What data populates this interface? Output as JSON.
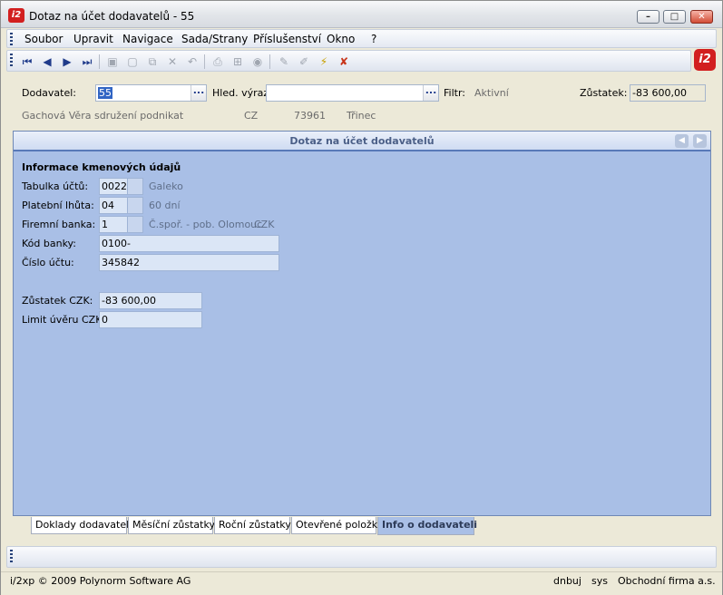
{
  "window": {
    "app_icon_text": "i2",
    "title": "Dotaz na účet dodavatelů - 55",
    "min_label": "–",
    "max_label": "□",
    "close_label": "✕"
  },
  "menu": {
    "items": [
      "Soubor",
      "Upravit",
      "Navigace",
      "Sada/Strany",
      "Příslušenství",
      "Okno",
      "?"
    ]
  },
  "toolbar": {
    "icons": [
      {
        "name": "first-record-icon",
        "glyph": "⏮"
      },
      {
        "name": "prev-record-icon",
        "glyph": "◀"
      },
      {
        "name": "next-record-icon",
        "glyph": "▶"
      },
      {
        "name": "last-record-icon",
        "glyph": "⏭"
      },
      {
        "name": "save-icon",
        "glyph": "▣"
      },
      {
        "name": "new-icon",
        "glyph": "▢"
      },
      {
        "name": "copy-icon",
        "glyph": "⧉"
      },
      {
        "name": "delete-icon",
        "glyph": "✕"
      },
      {
        "name": "undo-icon",
        "glyph": "↶"
      },
      {
        "name": "print-icon",
        "glyph": "⎙"
      },
      {
        "name": "tree-icon",
        "glyph": "⊞"
      },
      {
        "name": "stop-icon",
        "glyph": "◉"
      },
      {
        "name": "edit-icon",
        "glyph": "✎"
      },
      {
        "name": "highlight-icon",
        "glyph": "✐"
      },
      {
        "name": "magic-icon",
        "glyph": "⚡"
      },
      {
        "name": "filter-off-icon",
        "glyph": "✘"
      }
    ],
    "brand_text": "i2"
  },
  "filter": {
    "dodavatel_label": "Dodavatel:",
    "dodavatel_value": "55",
    "hled_label": "Hled. výraz:",
    "hled_value": "",
    "filtr_label": "Filtr:",
    "filtr_value": "Aktivní",
    "zustatek_label": "Zůstatek:",
    "zustatek_value": "-83 600,00",
    "dots": "...",
    "supplier_name": "Gachová Věra sdružení podnikat",
    "country": "CZ",
    "zip": "73961",
    "city": "Třinec"
  },
  "panel": {
    "title": "Dotaz na účet dodavatelů",
    "section_title": "Informace kmenových údajů",
    "fields": {
      "tabulka_uctu_label": "Tabulka účtů:",
      "tabulka_uctu_value": "0022",
      "tabulka_uctu_desc": "Galeko",
      "platebni_lhuta_label": "Platební lhůta:",
      "platebni_lhuta_value": "04",
      "platebni_lhuta_desc": "60 dní",
      "firemni_banka_label": "Firemní banka:",
      "firemni_banka_value": "1",
      "firemni_banka_desc": "Č.spoř. - pob. Olomouc",
      "firemni_banka_currency": "CZK",
      "kod_banky_label": "Kód banky:",
      "kod_banky_value": "0100-",
      "cislo_uctu_label": "Číslo účtu:",
      "cislo_uctu_value": "345842",
      "zustatek_czk_label": "Zůstatek CZK:",
      "zustatek_czk_value": "-83 600,00",
      "limit_uveru_label": "Limit úvěru CZK:",
      "limit_uveru_value": "0"
    }
  },
  "tabs": [
    "Doklady dodavatele",
    "Měsíční zůstatky",
    "Roční zůstatky",
    "Otevřené položky",
    "Info o dodavateli"
  ],
  "status": {
    "copyright": "i/2xp © 2009 Polynorm Software AG",
    "user": "dnbuj",
    "db": "sys",
    "company": "Obchodní firma a.s."
  }
}
